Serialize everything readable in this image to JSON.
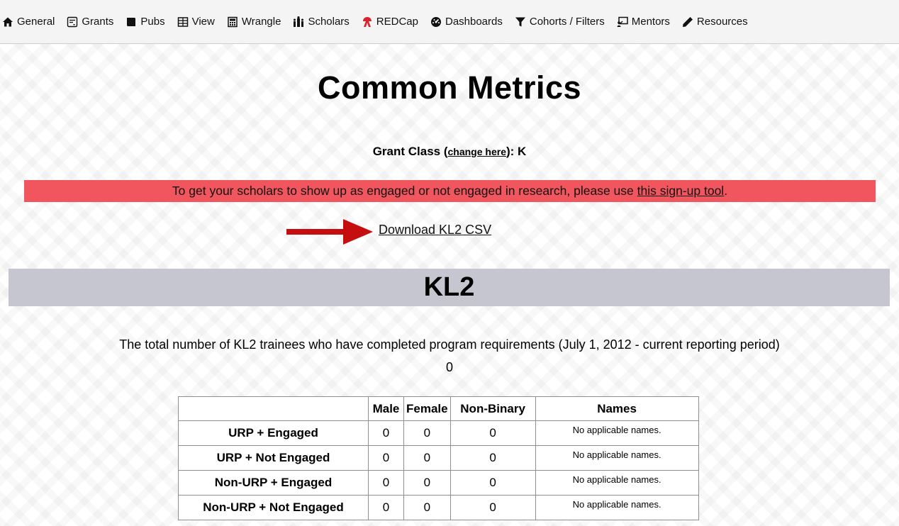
{
  "nav": {
    "items": [
      {
        "label": "General",
        "icon": "home-icon"
      },
      {
        "label": "Grants",
        "icon": "grants-icon"
      },
      {
        "label": "Pubs",
        "icon": "book-icon"
      },
      {
        "label": "View",
        "icon": "table-icon"
      },
      {
        "label": "Wrangle",
        "icon": "calculator-icon"
      },
      {
        "label": "Scholars",
        "icon": "scholars-icon"
      },
      {
        "label": "REDCap",
        "icon": "redcap-icon"
      },
      {
        "label": "Dashboards",
        "icon": "dashboard-icon"
      },
      {
        "label": "Cohorts / Filters",
        "icon": "filter-icon"
      },
      {
        "label": "Mentors",
        "icon": "mentors-icon"
      },
      {
        "label": "Resources",
        "icon": "pencil-icon"
      }
    ]
  },
  "page": {
    "title": "Common Metrics",
    "grant_class_prefix": "Grant Class (",
    "grant_class_link": "change here",
    "grant_class_suffix": "): K",
    "alert_text": "To get your scholars to show up as engaged or not engaged in research, please use ",
    "alert_link": "this sign-up tool",
    "alert_end": ".",
    "download_link": "Download KL2 CSV",
    "section_title": "KL2",
    "total_description": "The total number of KL2 trainees who have completed program requirements (July 1, 2012 - current reporting period)",
    "total_value": "0"
  },
  "table": {
    "headers": [
      "",
      "Male",
      "Female",
      "Non-Binary",
      "Names"
    ],
    "rows": [
      {
        "label": "URP + Engaged",
        "male": "0",
        "female": "0",
        "nonbinary": "0",
        "names": "No applicable names."
      },
      {
        "label": "URP + Not Engaged",
        "male": "0",
        "female": "0",
        "nonbinary": "0",
        "names": "No applicable names."
      },
      {
        "label": "Non-URP + Engaged",
        "male": "0",
        "female": "0",
        "nonbinary": "0",
        "names": "No applicable names."
      },
      {
        "label": "Non-URP + Not Engaged",
        "male": "0",
        "female": "0",
        "nonbinary": "0",
        "names": "No applicable names."
      }
    ]
  },
  "colors": {
    "alert_bg": "#f1565e",
    "section_bg": "#c6c6d0",
    "arrow": "#c40e10",
    "redcap_icon": "#d6262c"
  }
}
